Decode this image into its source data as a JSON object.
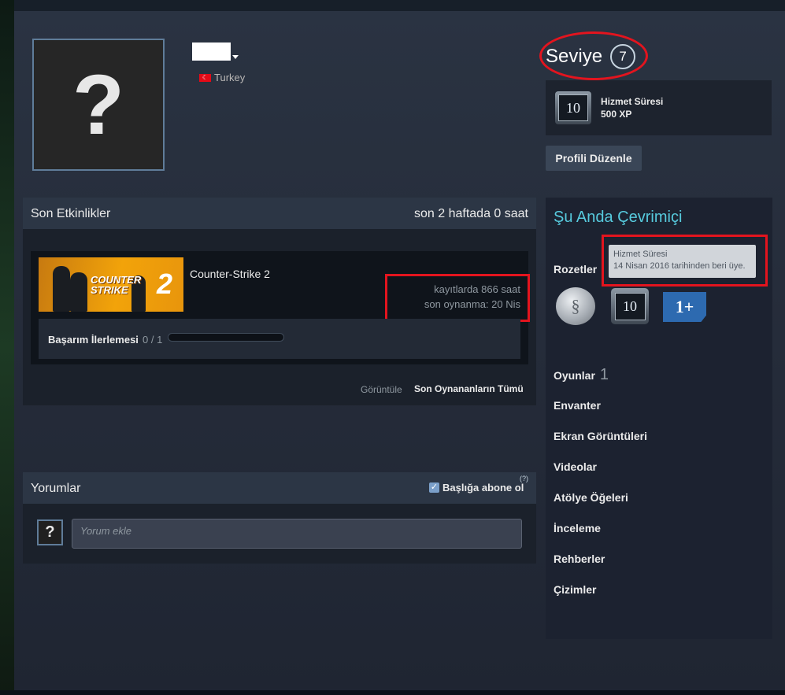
{
  "profile": {
    "country": "Turkey",
    "avatar_glyph": "?"
  },
  "level": {
    "label": "Seviye",
    "value": "7"
  },
  "featured_badge": {
    "name": "Hizmet Süresi",
    "xp": "500 XP",
    "icon_text": "10"
  },
  "edit_profile_label": "Profili Düzenle",
  "activity": {
    "title": "Son Etkinlikler",
    "summary": "son 2 haftada 0 saat",
    "game": {
      "name": "Counter-Strike 2",
      "hours": "kayıtlarda 866 saat",
      "last_played": "son oynanma: 20 Nis",
      "thumb_logo": "COUNTER STRIKE",
      "thumb_number": "2",
      "achievement_label": "Başarım İlerlemesi",
      "achievement_count": "0 / 1",
      "achievement_progress": 0
    },
    "view_label": "Görüntüle",
    "view_link": "Son Oynananların Tümü"
  },
  "comments": {
    "title": "Yorumlar",
    "subscribe_label": "Başlığa abone ol",
    "subscribe_checked": true,
    "help": "(?)",
    "placeholder": "Yorum ekle",
    "avatar_glyph": "?"
  },
  "sidebar": {
    "status": "Şu Anda Çevrimiçi",
    "badges_label": "Rozetler",
    "tooltip_title": "Hizmet Süresi",
    "tooltip_text": "14 Nisan 2016 tarihinden beri üye.",
    "badge_icons": [
      "coin-badge-icon",
      "years-of-service-badge-icon",
      "one-plus-badge-icon"
    ],
    "badge_b_text": "10",
    "badge_c_text": "1+",
    "games_label": "Oyunlar",
    "games_count": "1",
    "items": [
      "Envanter",
      "Ekran Görüntüleri",
      "Videolar",
      "Atölye Öğeleri",
      "İnceleme",
      "Rehberler",
      "Çizimler"
    ]
  },
  "colors": {
    "highlight": "#e3141e",
    "online": "#57cbde",
    "background": "#262d3b"
  }
}
